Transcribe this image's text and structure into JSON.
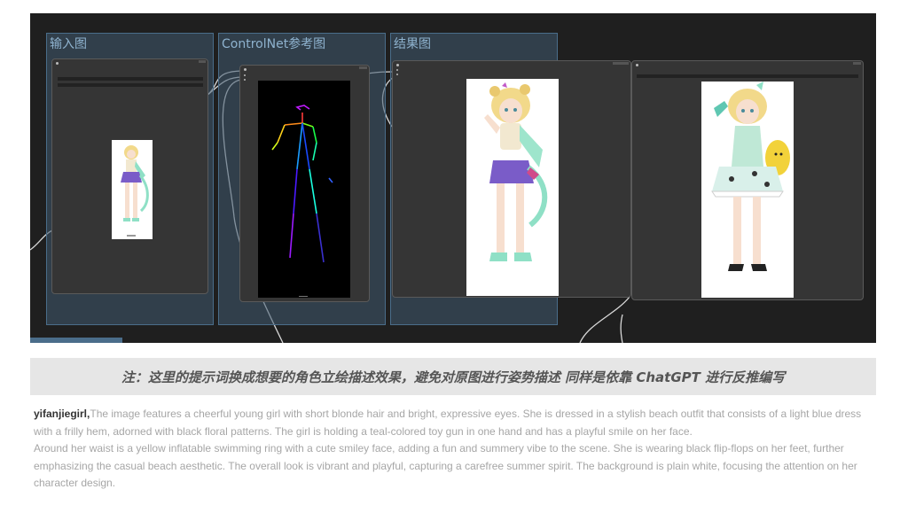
{
  "workflow": {
    "groups": [
      {
        "id": "input",
        "title": "输入图"
      },
      {
        "id": "controlnet",
        "title": "ControlNet参考图"
      },
      {
        "id": "result",
        "title": "结果图"
      }
    ],
    "bottom_tab": "",
    "colors": {
      "canvas": "#1f1f1f",
      "group_fill": "#3f5970",
      "group_border": "#4a6d8a",
      "node_fill": "#353535",
      "link": "#d8d8d8",
      "pose_bg": "#000000"
    }
  },
  "note": {
    "text": "注：这里的提示词换成想要的角色立绘描述效果，避免对原图进行姿势描述 同样是依靠 ChatGPT 进行反推编写"
  },
  "description": {
    "keyword": "yifanjiegirl,",
    "paragraph1": "The image features a cheerful young girl with short blonde hair and bright, expressive eyes. She is dressed in a stylish beach outfit that consists of a light blue dress with a frilly hem, adorned with black floral patterns. The girl is holding a teal-colored toy gun in one hand and has a playful smile on her face.",
    "paragraph2": "Around her waist is a yellow inflatable swimming ring with a cute smiley face, adding a fun and summery vibe to the scene. She is wearing black flip-flops on her feet, further emphasizing the casual beach aesthetic. The overall look is vibrant and playful, capturing a carefree summer spirit. The background is plain white, focusing the attention on her character design."
  }
}
